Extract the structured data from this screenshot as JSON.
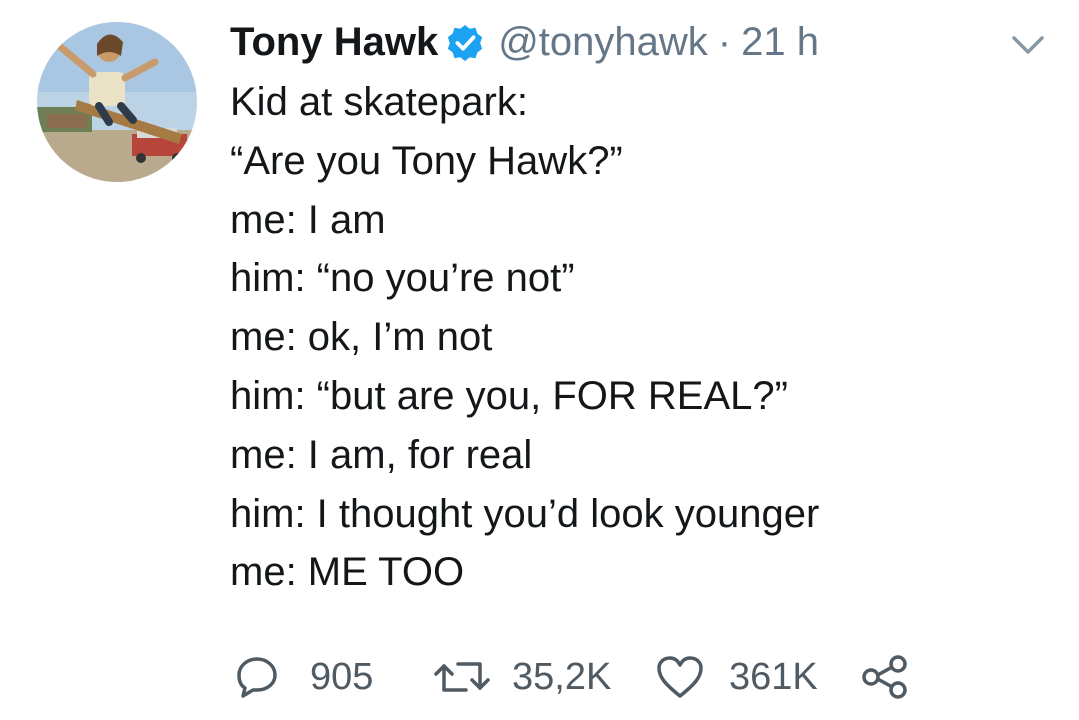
{
  "tweet": {
    "display_name": "Tony Hawk",
    "handle": "@tonyhawk",
    "separator": "·",
    "time": "21 h",
    "lines": [
      "Kid at skatepark:",
      "“Are you Tony Hawk?”",
      "me: I am",
      "him: “no you’re not”",
      "me: ok, I’m not",
      "him: “but are you, FOR REAL?”",
      "me: I am, for real",
      "him: I thought you’d look younger",
      "me: ME TOO"
    ],
    "replies": "905",
    "retweets": "35,2K",
    "likes": "361K"
  },
  "icons": {
    "verified": "verified-badge-icon",
    "menu": "chevron-down-icon",
    "reply": "reply-icon",
    "retweet": "retweet-icon",
    "like": "heart-icon",
    "share": "share-icon"
  },
  "colors": {
    "verified_blue": "#1da1f2",
    "text": "#14171a",
    "muted": "#657786"
  }
}
